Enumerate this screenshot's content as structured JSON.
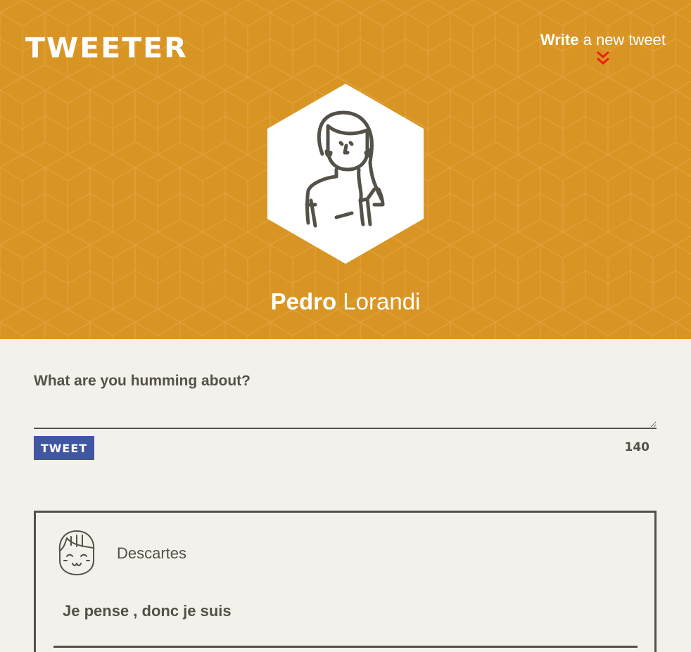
{
  "header": {
    "logo": "TWEETER",
    "compose_link": {
      "bold": "Write",
      "rest": " a new tweet"
    },
    "user": {
      "first_name": "Pedro",
      "last_name": " Lorandi"
    }
  },
  "compose": {
    "label": "What are you humming about?",
    "placeholder": "",
    "value": "",
    "tweet_button": "TWEET",
    "counter": "140"
  },
  "tweets": [
    {
      "author": "Descartes",
      "text": "Je pense , donc je suis"
    }
  ],
  "colors": {
    "header_bg": "#d99524",
    "page_bg": "#f4f1ec",
    "text": "#545149",
    "button": "#4056a1",
    "chevron": "#e8210f"
  },
  "icons": {
    "compose": "chevron-double-down-icon",
    "user_avatar": "woman-avatar-icon",
    "tweet_avatar": "smiling-girl-avatar-icon"
  }
}
